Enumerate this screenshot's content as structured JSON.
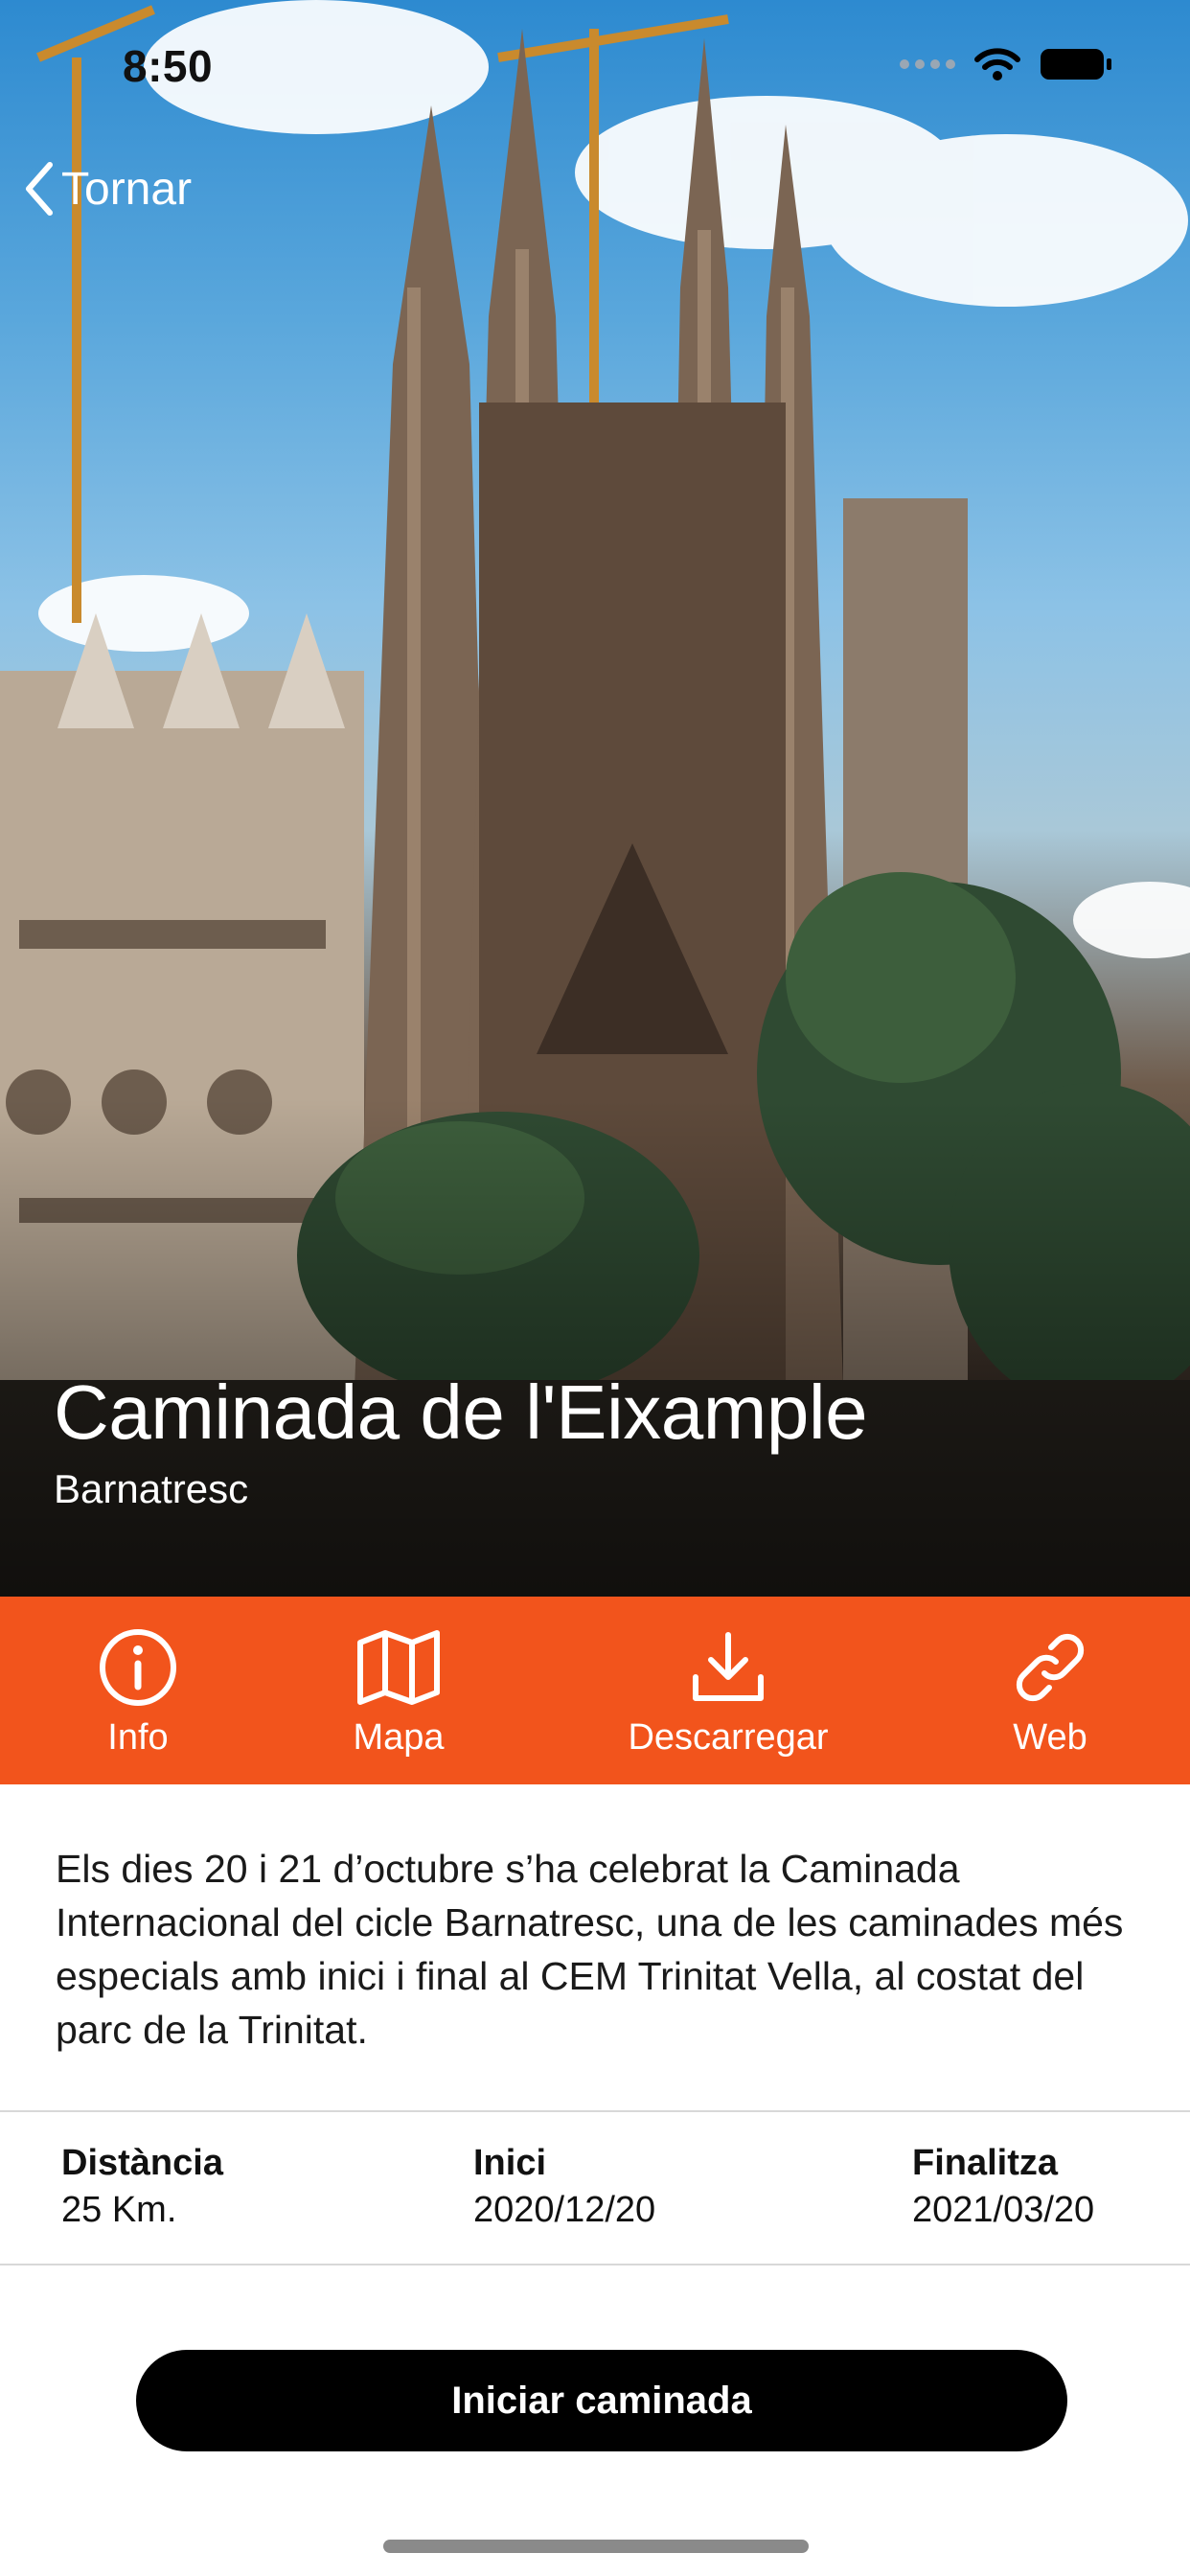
{
  "status_bar": {
    "time": "8:50"
  },
  "nav": {
    "back_label": "Tornar"
  },
  "hero": {
    "title": "Caminada de l'Eixample",
    "subtitle": "Barnatresc"
  },
  "actions": [
    {
      "label": "Info",
      "icon": "info-icon"
    },
    {
      "label": "Mapa",
      "icon": "map-icon"
    },
    {
      "label": "Descarregar",
      "icon": "download-icon"
    },
    {
      "label": "Web",
      "icon": "link-icon"
    }
  ],
  "description": "Els dies 20 i 21 d’octubre s’ha celebrat la Caminada Internacional del cicle Barnatresc, una de les caminades més especials amb inici i final al CEM Trinitat Vella, al costat del parc de la Trinitat.",
  "stats": [
    {
      "label": "Distància",
      "value": "25 Km."
    },
    {
      "label": "Inici",
      "value": "2020/12/20"
    },
    {
      "label": "Finalitza",
      "value": "2021/03/20"
    }
  ],
  "cta": {
    "label": "Iniciar caminada"
  },
  "colors": {
    "accent": "#f2541c",
    "button": "#000000"
  }
}
